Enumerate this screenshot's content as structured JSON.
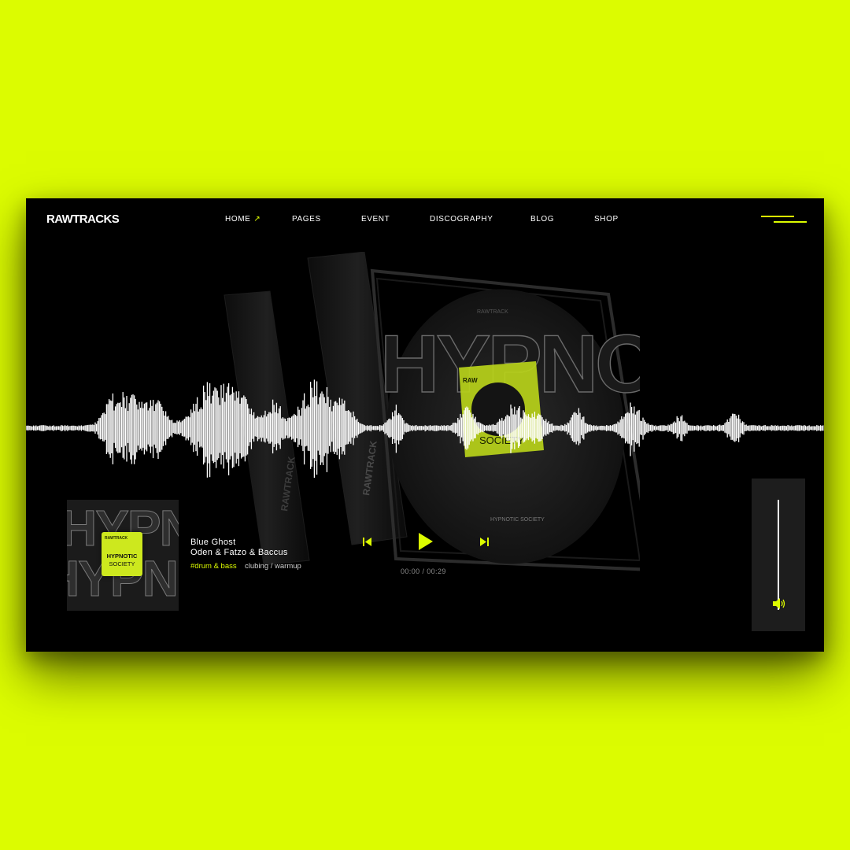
{
  "brand": {
    "logo": "RAWTRACKS"
  },
  "nav": {
    "items": [
      {
        "label": "HOME",
        "active": true
      },
      {
        "label": "PAGES"
      },
      {
        "label": "EVENT"
      },
      {
        "label": "DISCOGRAPHY"
      },
      {
        "label": "BLOG"
      },
      {
        "label": "SHOP"
      }
    ],
    "active_icon": "arrow-up-right-icon",
    "menu_icon": "hamburger-menu-icon"
  },
  "hero": {
    "cd_case": {
      "brand": "RAWTRACK",
      "big_text": "HYPNO",
      "sticker_brand": "RAW",
      "sticker_title": "SOCIETY",
      "disc_text": "HYPNOTIC SOCIETY",
      "spine_text": "RAWTRACK"
    }
  },
  "player": {
    "cover": {
      "brand": "RAWTRACK",
      "title_line1": "HYPNOTIC",
      "title_line2": "SOCIETY",
      "bg_text": "HYPNOTIC"
    },
    "track": {
      "title": "Blue Ghost",
      "artist": "Oden & Fatzo & Baccus",
      "genre": "#drum & bass",
      "mood": "clubing / warmup"
    },
    "controls": {
      "prev_icon": "skip-previous-icon",
      "play_icon": "play-icon",
      "next_icon": "skip-next-icon"
    },
    "time": {
      "current": "00:00",
      "separator": "/",
      "total": "00:29"
    },
    "volume": {
      "level": 1.0,
      "icon": "speaker-icon"
    }
  },
  "colors": {
    "accent": "#dcfc00",
    "background": "#000000",
    "page": "#dcfc00",
    "panel": "#1d1d1d"
  }
}
